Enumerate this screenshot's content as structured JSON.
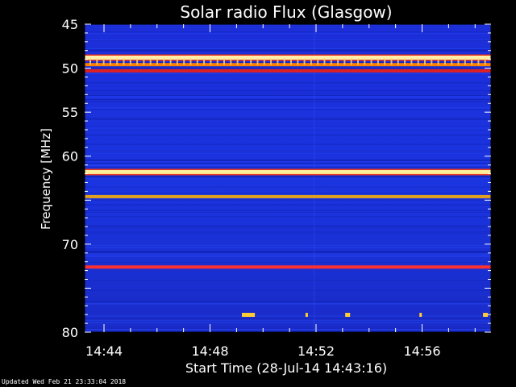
{
  "chart_data": {
    "type": "heatmap",
    "title": "Solar radio Flux (Glasgow)",
    "ylabel": "Frequency [MHz]",
    "xlabel": "Start Time (28-Jul-14 14:43:16)",
    "ylim": [
      45,
      80
    ],
    "y_inverted": true,
    "y_ticks": [
      45,
      50,
      55,
      60,
      65,
      70,
      75,
      80
    ],
    "y_tick_labels": [
      "45",
      "50",
      "55",
      "60",
      "",
      "70",
      "",
      "80"
    ],
    "x_range_minutes": [
      14.72,
      15.0
    ],
    "x_ticks": [
      "14:44",
      "14:48",
      "14:52",
      "14:56"
    ],
    "x_tick_minutes": [
      884,
      888,
      892,
      896
    ],
    "x_start_minutes": 883.27,
    "x_end_minutes": 898.6,
    "background_color": "#1a2fd0",
    "bands": [
      {
        "freq": 48.8,
        "level": "high",
        "color": "#ffeeaa"
      },
      {
        "freq": 49.6,
        "level": "medium",
        "color": "#ff8000"
      },
      {
        "freq": 50.3,
        "level": "medium",
        "color": "#e02020"
      },
      {
        "freq": 61.8,
        "level": "high",
        "color": "#ffee99"
      },
      {
        "freq": 64.6,
        "level": "medium",
        "color": "#e0a020"
      },
      {
        "freq": 72.6,
        "level": "medium",
        "color": "#ff3030"
      }
    ],
    "grid": false
  },
  "footer": "Updated Wed Feb 21 23:33:04 2018"
}
